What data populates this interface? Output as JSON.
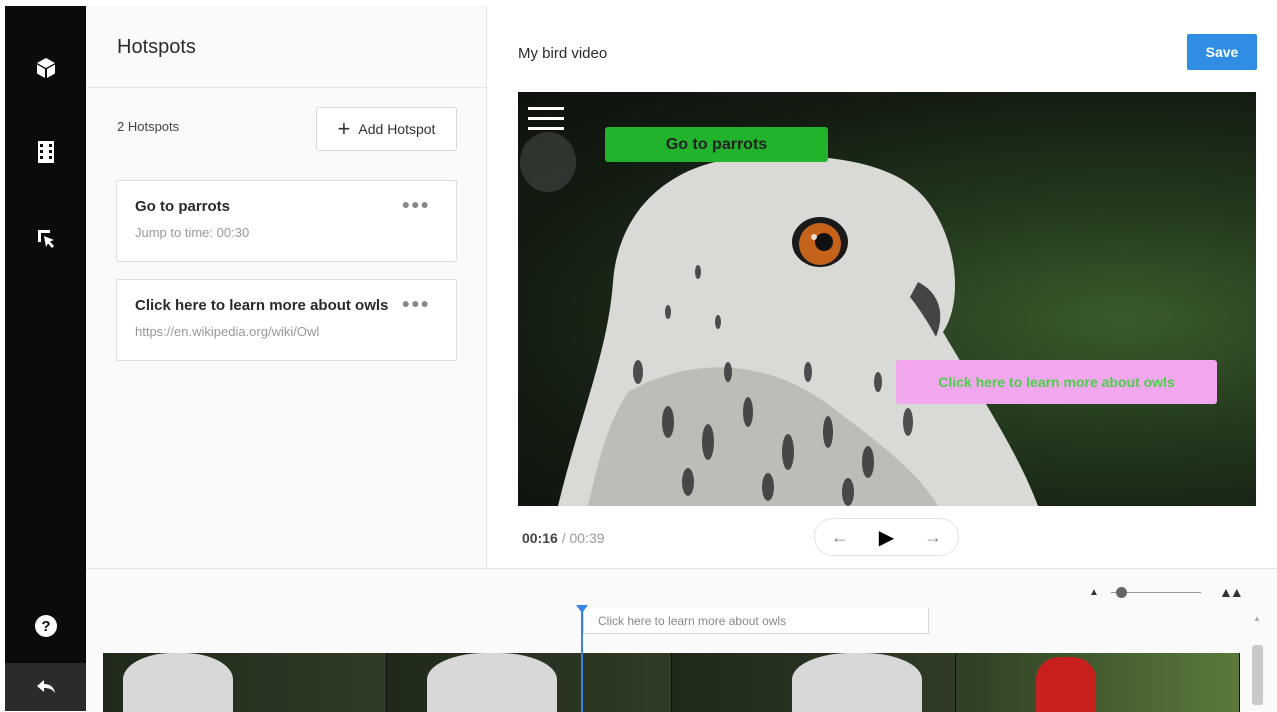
{
  "sidebar": {
    "icons": [
      "cube-icon",
      "film-icon",
      "pointer-icon",
      "help-icon",
      "back-icon"
    ]
  },
  "hotspots_panel": {
    "title": "Hotspots",
    "count_label": "2 Hotspots",
    "add_button": "Add Hotspot",
    "items": [
      {
        "title": "Go to parrots",
        "subtitle": "Jump to time: 00:30"
      },
      {
        "title": "Click here to learn more about owls",
        "subtitle": "https://en.wikipedia.org/wiki/Owl"
      }
    ]
  },
  "editor": {
    "video_title": "My bird video",
    "save_label": "Save",
    "hotspot_green": "Go to parrots",
    "hotspot_pink": "Click here to learn more about owls",
    "current_time": "00:16",
    "separator": "/",
    "total_time": "00:39",
    "prev_icon": "←",
    "play_icon": "▶",
    "next_icon": "→"
  },
  "timeline": {
    "hotspot_label": "Click here to learn more about owls",
    "zoom_min_icon": "▲",
    "zoom_max_icon": "▲▲",
    "zoom_level": 0.05
  },
  "colors": {
    "accent": "#2f8de4",
    "hotspot_green": "#22b32d",
    "hotspot_pink": "#f3a7ee",
    "playhead": "#3b83e0",
    "rail": "#0b0b0b"
  }
}
